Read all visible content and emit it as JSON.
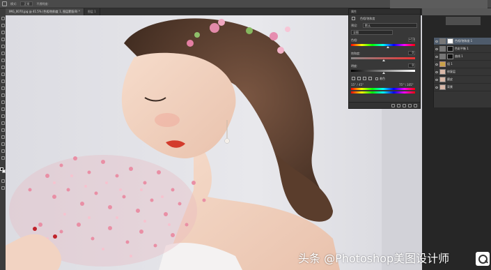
{
  "options_bar": {
    "blend_mode": "正常",
    "opacity_label": "不透明度:",
    "mode_label": "模式:",
    "flow_label": "流量:"
  },
  "document": {
    "tab_active": "IMG_0070.jpg @ 41.5% (色相/饱和度 1, 图层蒙版/8) *",
    "tab_2": "图层 1"
  },
  "properties": {
    "title": "属性",
    "adjustment_name": "色相/饱和度",
    "preset_label": "预设:",
    "preset_value": "默认",
    "channel_value": "全图",
    "hue_label": "色相:",
    "hue_value": "+13",
    "saturation_label": "饱和度:",
    "saturation_value": "0",
    "lightness_label": "明度:",
    "lightness_value": "0",
    "colorize_label": "着色",
    "range_left": "15° / 45°",
    "range_right": "75° \\ 105°"
  },
  "layers": {
    "items": [
      {
        "name": "色相/饱和度 1",
        "selected": true,
        "type": "adjust"
      },
      {
        "name": "色彩平衡 1",
        "selected": false,
        "type": "adjust"
      },
      {
        "name": "曲线 1",
        "selected": false,
        "type": "adjust"
      },
      {
        "name": "组 1",
        "selected": false,
        "type": "group"
      },
      {
        "name": "修复层",
        "selected": false,
        "type": "image"
      },
      {
        "name": "磨皮",
        "selected": false,
        "type": "image"
      },
      {
        "name": "背景",
        "selected": false,
        "type": "image"
      }
    ]
  },
  "watermark": {
    "text": "头条 @Photoshop美图设计师"
  },
  "colors": {
    "app_bg": "#282828",
    "panel_bg": "#383838",
    "selected_layer": "#4e5b6b",
    "canvas_bg": "#e6e6ea"
  }
}
